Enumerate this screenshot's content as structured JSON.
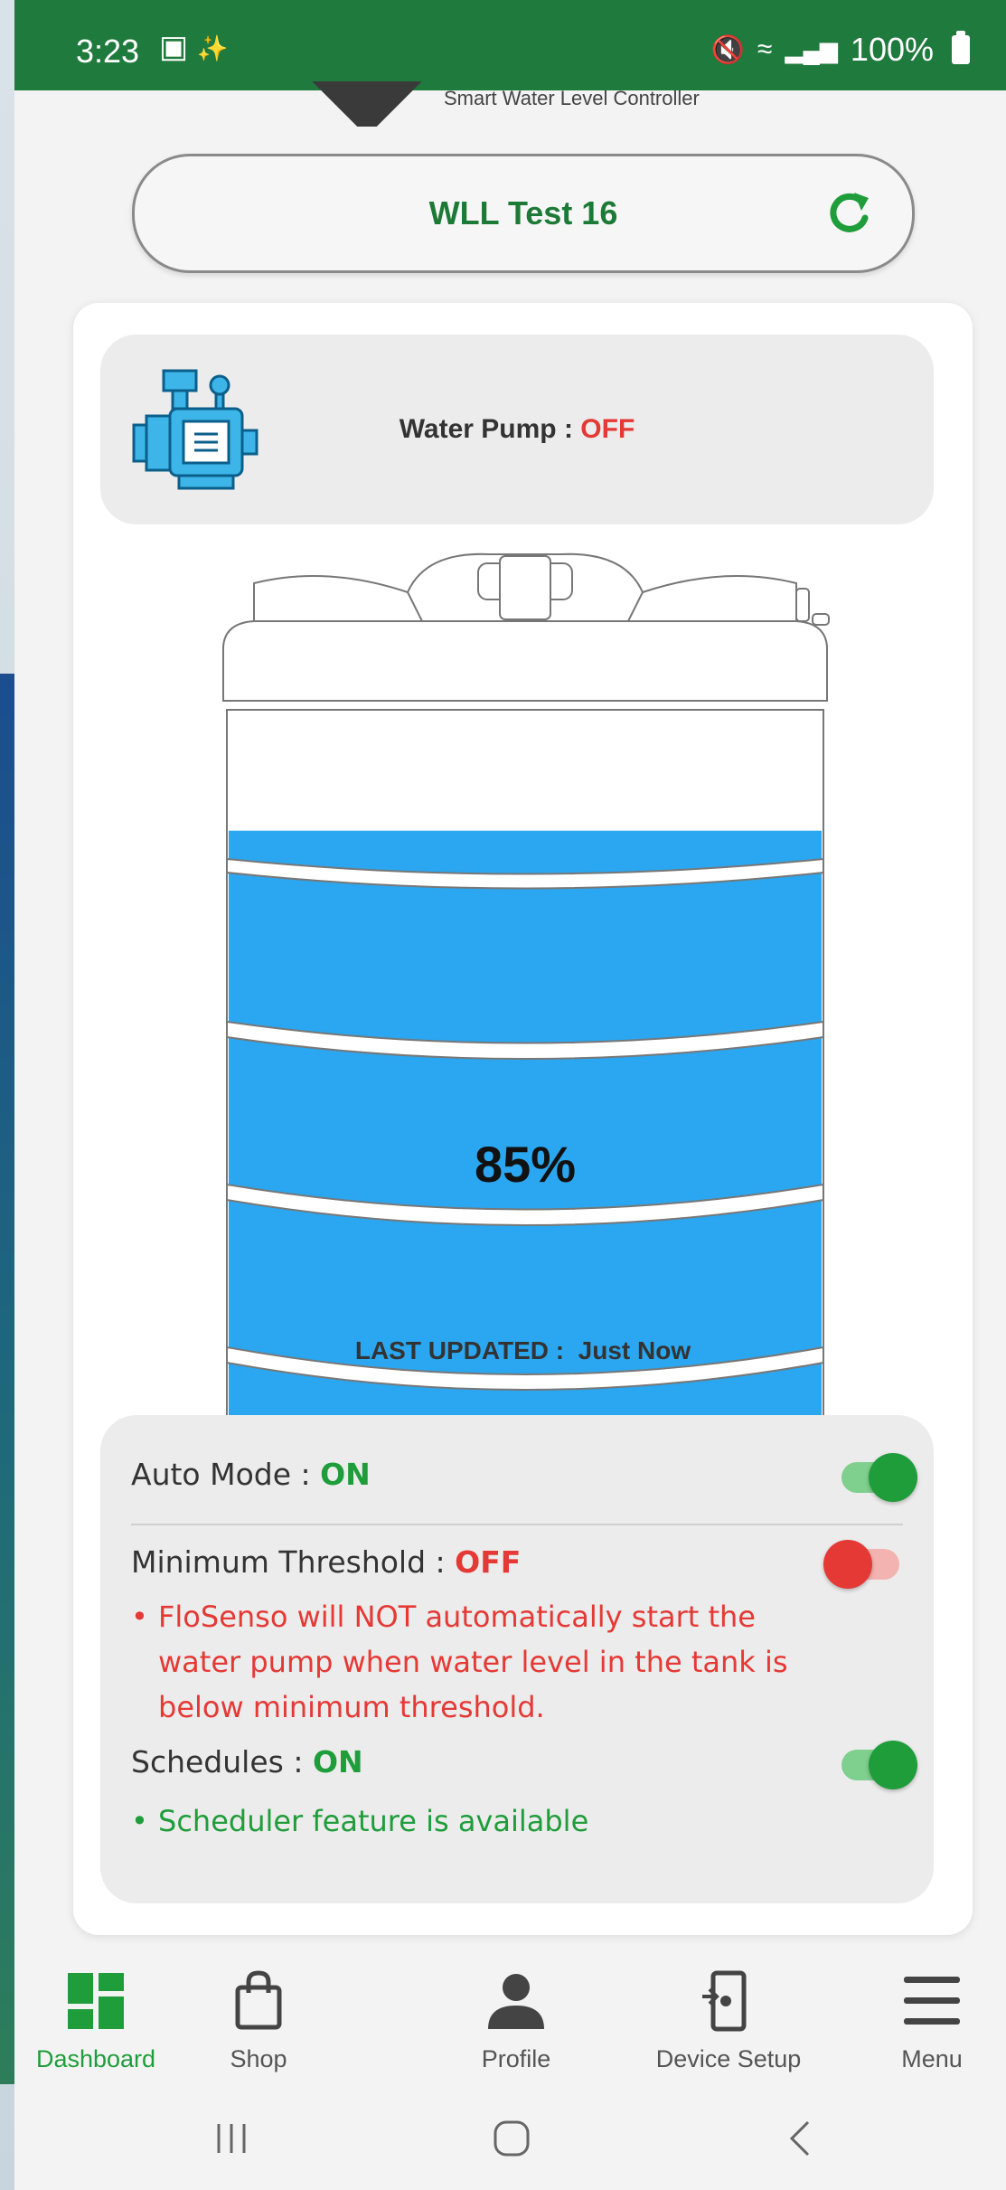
{
  "status_bar": {
    "time": "3:23",
    "battery": "100%"
  },
  "header": {
    "tagline": "Smart Water Level Controller",
    "device_name": "WLL Test 16"
  },
  "pump": {
    "label": "Water Pump : ",
    "state": "OFF"
  },
  "tank": {
    "level_percent": 85,
    "level_text": "85%",
    "water_color": "#2aa7f0"
  },
  "last_updated": {
    "label": "LAST UPDATED :",
    "value": "Just Now"
  },
  "settings": {
    "auto_mode": {
      "label": "Auto Mode : ",
      "state": "ON",
      "enabled": true
    },
    "min_threshold": {
      "label": "Minimum Threshold : ",
      "state": "OFF",
      "enabled": false,
      "note_line1": "FloSenso will NOT automatically start the",
      "note_line2": "water pump when water level in the tank is",
      "note_line3": "below minimum threshold."
    },
    "schedules": {
      "label": "Schedules : ",
      "state": "ON",
      "enabled": true,
      "note": "Scheduler feature is available"
    }
  },
  "bottom_nav": {
    "items": [
      {
        "label": "Dashboard",
        "icon": "dashboard-icon",
        "active": true
      },
      {
        "label": "Shop",
        "icon": "shopping-bag-icon",
        "active": false
      },
      {
        "label": "Profile",
        "icon": "user-icon",
        "active": false
      },
      {
        "label": "Device Setup",
        "icon": "device-setup-icon",
        "active": false
      },
      {
        "label": "Menu",
        "icon": "hamburger-menu-icon",
        "active": false
      }
    ]
  },
  "colors": {
    "brand_green": "#1f7a3d",
    "on_green": "#1f9d3a",
    "off_red": "#e53935"
  }
}
